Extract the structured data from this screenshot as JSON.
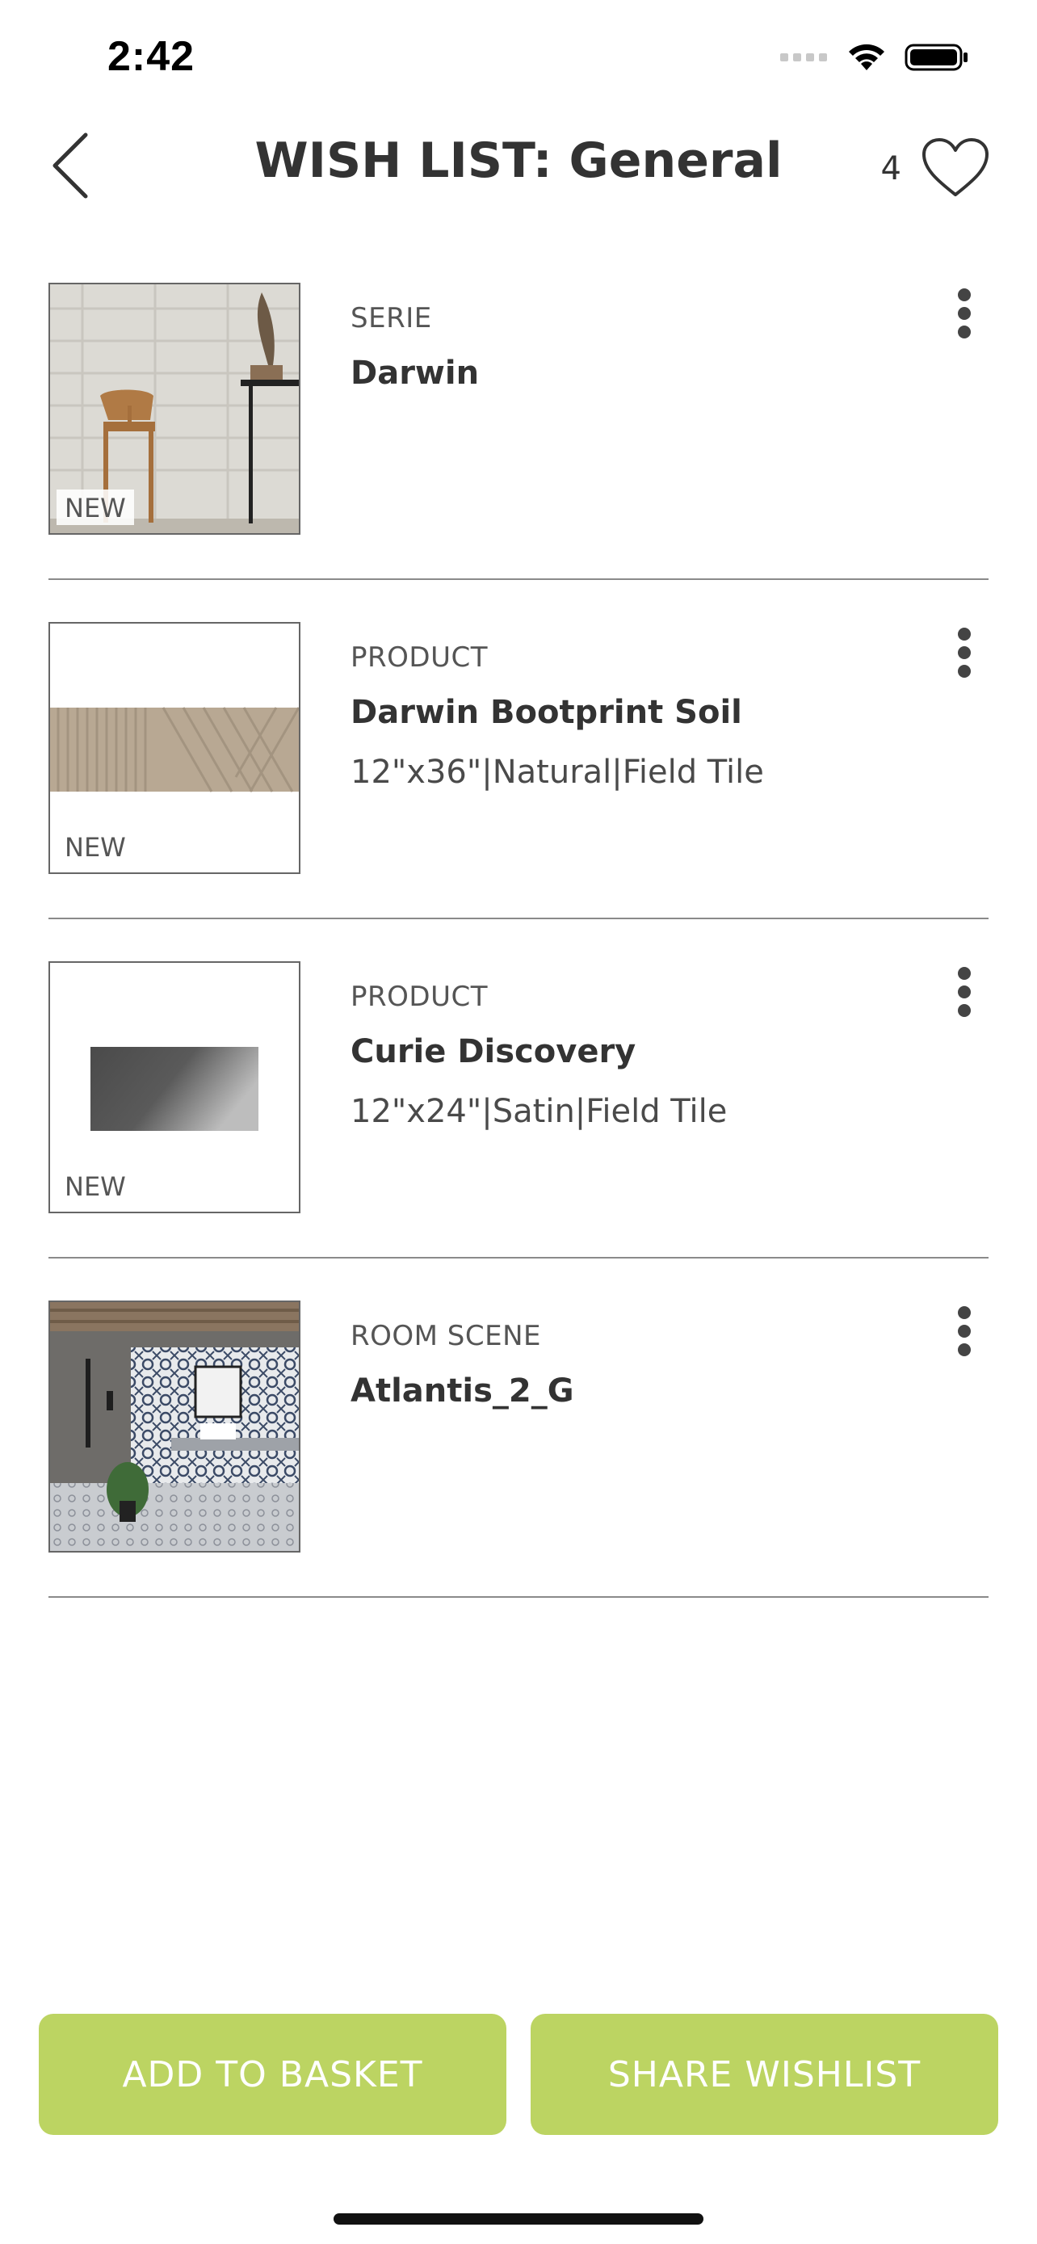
{
  "status_bar": {
    "time": "2:42",
    "icons": [
      "signal-icon",
      "wifi-icon",
      "battery-icon"
    ]
  },
  "header": {
    "title": "WISH LIST: General",
    "count": "4",
    "back_icon": "chevron-left-icon",
    "heart_icon": "heart-outline-icon"
  },
  "items": [
    {
      "type": "SERIE",
      "name": "Darwin",
      "meta": "",
      "badge": "NEW",
      "image": "interior-chair-scene"
    },
    {
      "type": "PRODUCT",
      "name": "Darwin Bootprint Soil",
      "meta": "12\"x36\"|Natural|Field Tile",
      "badge": "NEW",
      "image": "beige-textured-tile"
    },
    {
      "type": "PRODUCT",
      "name": "Curie Discovery",
      "meta": "12\"x24\"|Satin|Field Tile",
      "badge": "NEW",
      "image": "dark-gray-tile"
    },
    {
      "type": "ROOM SCENE",
      "name": "Atlantis_2_G",
      "meta": "",
      "badge": "",
      "image": "bathroom-pattern-scene"
    }
  ],
  "actions": {
    "add_to_basket": "ADD TO BASKET",
    "share_wishlist": "SHARE WISHLIST"
  },
  "colors": {
    "accent": "#bcd462",
    "text": "#333333",
    "divider": "#8a8a8a"
  }
}
